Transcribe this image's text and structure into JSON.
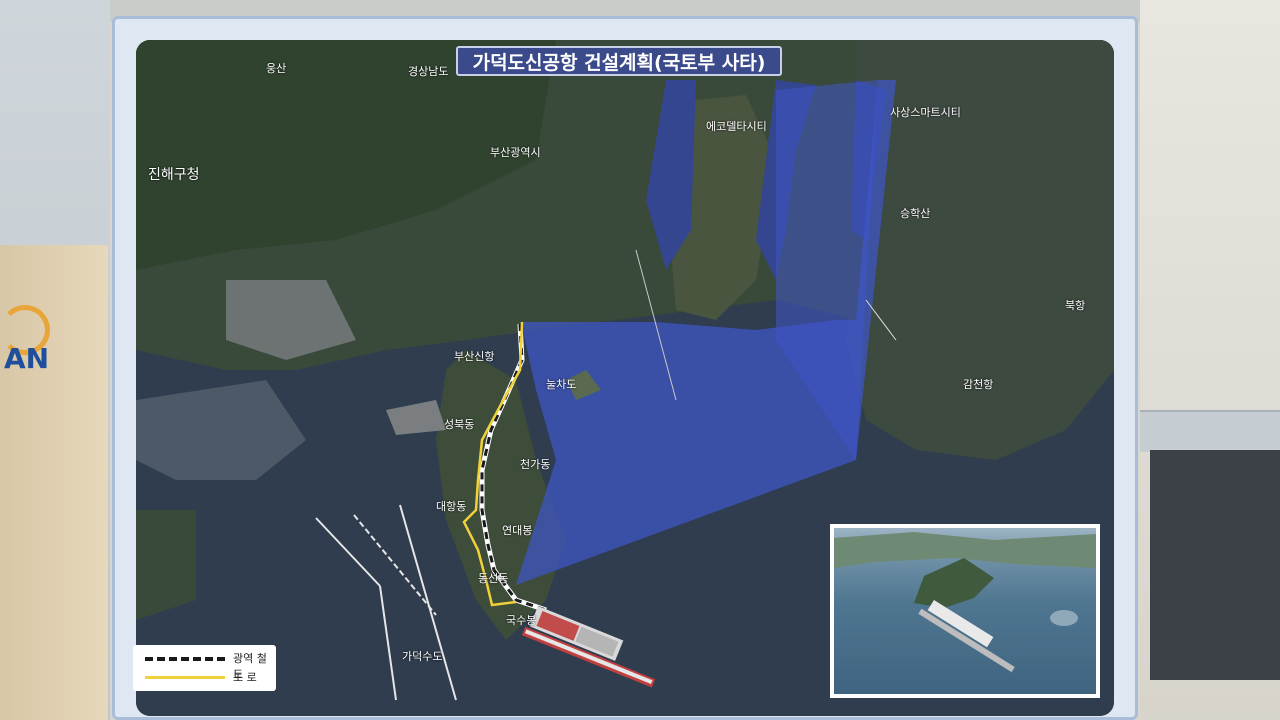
{
  "board": {
    "title": "가덕도신공항 건설계획(국토부 사타)"
  },
  "colors": {
    "title_bg": "#3a4a8a",
    "overlay_blue": "#3f56c8",
    "rail": "#1a1a1a",
    "road": "#f0d13a"
  },
  "places": {
    "jinhae": "진해구청",
    "gyeongsangnamdo": "경상남도",
    "busan_city": "부산광역시",
    "eco_delta": "에코델타시티",
    "sasang": "사상스마트시티",
    "busan_newport": "부산신항",
    "gamcheon": "감천항",
    "bukhang": "북항",
    "nulcha": "눌차도",
    "gadeok_south": "국수봉",
    "yeondaebong": "연대봉",
    "gadeok_canal": "가덕수도",
    "hill_top": "웅산",
    "east_label": "승학산",
    "mid_label1": "성북동",
    "mid_label2": "천가동",
    "mid_label3": "대항동",
    "mid_label4": "동선동"
  },
  "legend": {
    "rail_label": "광역 철도",
    "road_label": "도   로"
  },
  "room": {
    "logo_text": "AN"
  },
  "icons": {
    "rail": "dashed-line-icon",
    "road": "solid-line-icon"
  }
}
